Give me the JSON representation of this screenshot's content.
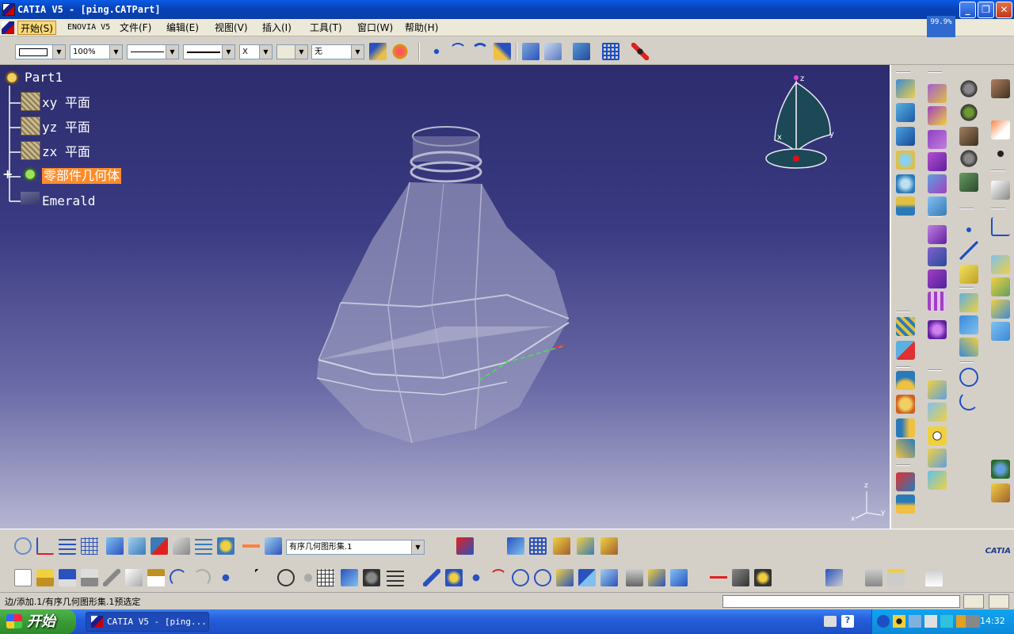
{
  "window": {
    "title": "CATIA V5 - [ping.CATPart]"
  },
  "menu": {
    "items": [
      {
        "label": "开始(S)",
        "active": true
      },
      {
        "label": "ENOVIA V5"
      },
      {
        "label": "文件(F)"
      },
      {
        "label": "编辑(E)"
      },
      {
        "label": "视图(V)"
      },
      {
        "label": "插入(I)"
      },
      {
        "label": "工具(T)"
      },
      {
        "label": "窗口(W)"
      },
      {
        "label": "帮助(H)"
      }
    ],
    "progress_badge": "99.9%"
  },
  "properties_toolbar": {
    "zoom_value": "100%",
    "layer_value": "无",
    "linetype_symbol": "X"
  },
  "tree": {
    "root": "Part1",
    "items": [
      {
        "label": "xy 平面"
      },
      {
        "label": "yz 平面"
      },
      {
        "label": "zx 平面"
      },
      {
        "label": "零部件几何体",
        "selected": true
      },
      {
        "label": "Emerald"
      }
    ]
  },
  "compass": {
    "x": "x",
    "y": "y",
    "z": "z"
  },
  "axis_triad": {
    "x": "x",
    "y": "y",
    "z": "z"
  },
  "bottom_toolbar": {
    "geometric_set": "有序几何图形集.1"
  },
  "brand": {
    "logo_text": "CATIA"
  },
  "status": {
    "message": "边/添加.1/有序几何图形集.1预选定"
  },
  "taskbar": {
    "start_label": "开始",
    "task_label": "CATIA V5 - [ping...",
    "clock": "14:32"
  },
  "colors": {
    "title_blue": "#0a3ea8",
    "selection_orange": "#ff8c2a",
    "viewport_top": "#2c2c6e",
    "viewport_bottom": "#b6b6d2"
  }
}
